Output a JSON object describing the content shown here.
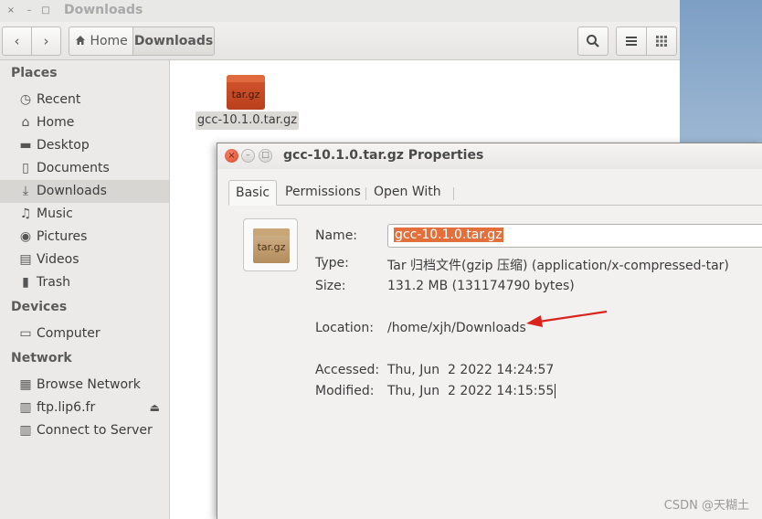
{
  "window": {
    "title": "Downloads",
    "controls": {
      "close": "×",
      "minimize": "–",
      "maximize": "□"
    }
  },
  "toolbar": {
    "back": "‹",
    "forward": "›",
    "breadcrumbs": [
      {
        "label": "Home",
        "icon": "home-icon"
      },
      {
        "label": "Downloads"
      }
    ],
    "search_icon": "search-icon",
    "list_icon": "list-view-icon",
    "grid_icon": "grid-view-icon"
  },
  "sidebar": {
    "places_heading": "Places",
    "places": [
      {
        "label": "Recent",
        "icon": "clock-icon"
      },
      {
        "label": "Home",
        "icon": "home-icon"
      },
      {
        "label": "Desktop",
        "icon": "folder-icon"
      },
      {
        "label": "Documents",
        "icon": "document-icon"
      },
      {
        "label": "Downloads",
        "icon": "download-icon",
        "active": true
      },
      {
        "label": "Music",
        "icon": "music-icon"
      },
      {
        "label": "Pictures",
        "icon": "camera-icon"
      },
      {
        "label": "Videos",
        "icon": "film-icon"
      },
      {
        "label": "Trash",
        "icon": "trash-icon"
      }
    ],
    "devices_heading": "Devices",
    "devices": [
      {
        "label": "Computer",
        "icon": "computer-icon"
      }
    ],
    "network_heading": "Network",
    "network": [
      {
        "label": "Browse Network",
        "icon": "network-icon"
      },
      {
        "label": "ftp.lip6.fr",
        "icon": "server-icon",
        "eject": true
      },
      {
        "label": "Connect to Server",
        "icon": "server-icon"
      }
    ]
  },
  "files": [
    {
      "name": "gcc-10.1.0.tar.gz",
      "icon_text": "tar.gz"
    }
  ],
  "dialog": {
    "title": "gcc-10.1.0.tar.gz Properties",
    "controls": {
      "close": "×",
      "minimize": "–",
      "maximize": "□"
    },
    "tabs": [
      {
        "label": "Basic",
        "active": true
      },
      {
        "label": "Permissions"
      },
      {
        "label": "Open With"
      }
    ],
    "icon_text": "tar.gz",
    "fields": {
      "name_label": "Name:",
      "name_value": "gcc-10.1.0.tar.gz",
      "type_label": "Type:",
      "type_value": "Tar 归档文件(gzip 压缩) (application/x-compressed-tar)",
      "size_label": "Size:",
      "size_value": "131.2 MB (131174790 bytes)",
      "location_label": "Location:",
      "location_value": "/home/xjh/Downloads",
      "accessed_label": "Accessed:",
      "accessed_value": "Thu, Jun  2 2022 14:24:57",
      "modified_label": "Modified:",
      "modified_value": "Thu, Jun  2 2022 14:15:55"
    }
  },
  "annotation": {
    "arrow_color": "#d9231c"
  },
  "watermark": "CSDN @天糊土"
}
